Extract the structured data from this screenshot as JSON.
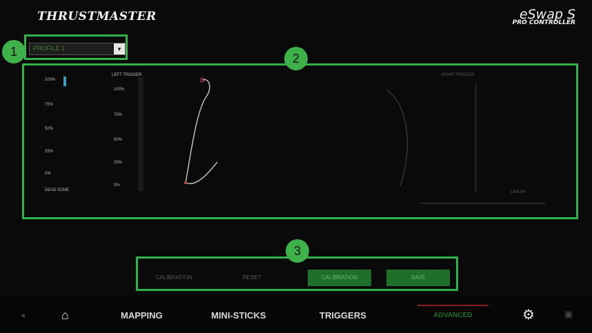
{
  "header": {
    "logo": "THRUSTMASTER",
    "product_main": "eSwap S",
    "product_sub": "PRO CONTROLLER"
  },
  "badges": [
    "1",
    "2",
    "3"
  ],
  "profile": {
    "selected": "PROFILE 1"
  },
  "panel": {
    "left_labels": [
      "100%",
      "75%",
      "50%",
      "25%",
      "0%",
      "DEAD ZONE"
    ],
    "left_values": [
      "100%",
      "75%",
      "50%",
      "25%",
      "0%",
      "0%"
    ],
    "left_header": "LEFT TRIGGER",
    "right_header": "RIGHT TRIGGER",
    "right_footer": "LINEAR"
  },
  "actions": {
    "calibration": "CALIBRATION",
    "reset": "RESET",
    "save": "SAVE"
  },
  "nav": {
    "mapping": "MAPPING",
    "mini_sticks": "MINI-STICKS",
    "triggers": "TRIGGERS",
    "advanced": "ADVANCED"
  },
  "colors": {
    "accent": "#2fb34a",
    "badge": "#3fb14a",
    "button_green": "#1f6f2b"
  }
}
